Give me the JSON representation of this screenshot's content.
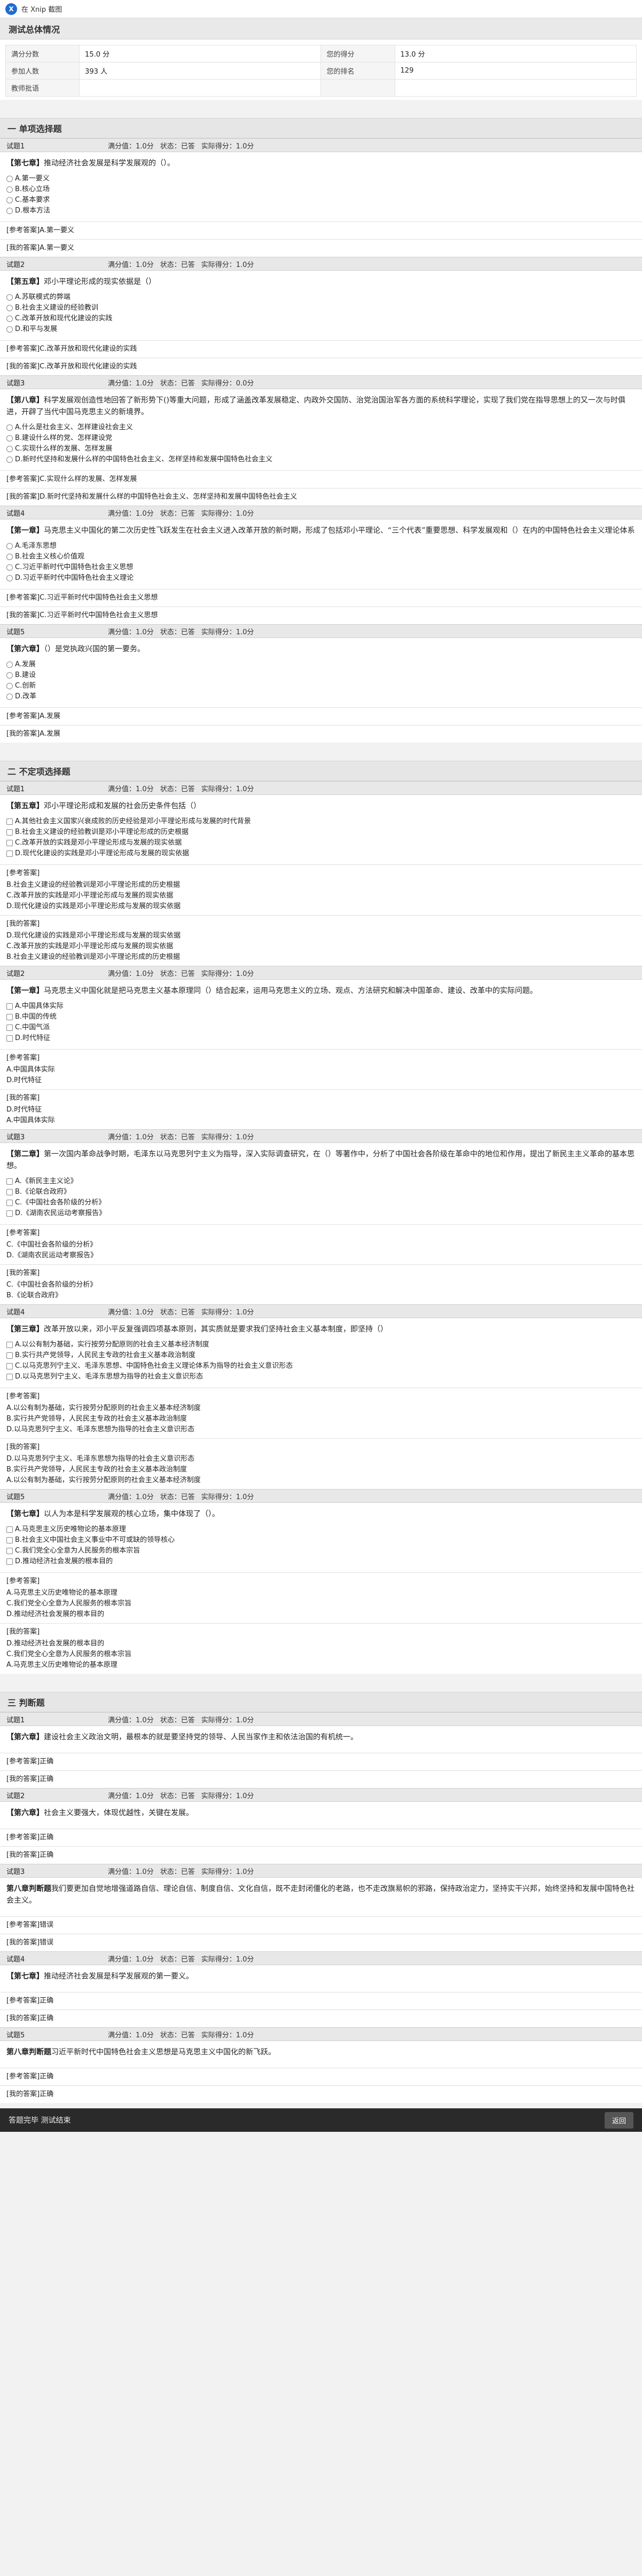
{
  "app": {
    "brand": "在 Xnip 截图",
    "logo_letter": "X"
  },
  "overview": {
    "title": "测试总体情况",
    "rows": [
      {
        "l1": "满分分数",
        "v1": "15.0 分",
        "l2": "您的得分",
        "v2": "13.0 分"
      },
      {
        "l1": "参加人数",
        "v1": "393 人",
        "l2": "您的排名",
        "v2": "129"
      },
      {
        "l1": "教师批语",
        "v1": "",
        "l2": "",
        "v2": ""
      }
    ]
  },
  "labels": {
    "full": "满分值：",
    "status": "状态：",
    "actual": "实际得分：",
    "ref": "[参考答案]",
    "mine": "[我的答案]"
  },
  "sections": [
    {
      "title": "一 单项选择题",
      "questions": [
        {
          "no": "试题1",
          "full": "1.0分",
          "status": "已答",
          "score": "1.0分",
          "tag": "【第七章】",
          "stem": "推动经济社会发展是科学发展观的（）。",
          "options": [
            "A.第一要义",
            "B.核心立场",
            "C.基本要求",
            "D.根本方法"
          ],
          "ref": "A.第一要义",
          "mine": "A.第一要义"
        },
        {
          "no": "试题2",
          "full": "1.0分",
          "status": "已答",
          "score": "1.0分",
          "tag": "【第五章】",
          "stem": "邓小平理论形成的现实依据是（）",
          "options": [
            "A.苏联模式的弊端",
            "B.社会主义建设的经验教训",
            "C.改革开放和现代化建设的实践",
            "D.和平与发展"
          ],
          "ref": "C.改革开放和现代化建设的实践",
          "mine": "C.改革开放和现代化建设的实践"
        },
        {
          "no": "试题3",
          "full": "1.0分",
          "status": "已答",
          "score": "0.0分",
          "tag": "【第八章】",
          "stem": "科学发展观创造性地回答了新形势下()等重大问题，形成了涵盖改革发展稳定、内政外交国防、治党治国治军各方面的系统科学理论，实现了我们党在指导思想上的又一次与时俱进，开辟了当代中国马克思主义的新境界。",
          "options": [
            "A.什么是社会主义、怎样建设社会主义",
            "B.建设什么样的党、怎样建设党",
            "C.实现什么样的发展、怎样发展",
            "D.新时代坚持和发展什么样的中国特色社会主义、怎样坚持和发展中国特色社会主义"
          ],
          "ref": "C.实现什么样的发展、怎样发展",
          "mine": "D.新时代坚持和发展什么样的中国特色社会主义、怎样坚持和发展中国特色社会主义"
        },
        {
          "no": "试题4",
          "full": "1.0分",
          "status": "已答",
          "score": "1.0分",
          "tag": "【第一章】",
          "stem": "马克思主义中国化的第二次历史性飞跃发生在社会主义进入改革开放的新时期，形成了包括邓小平理论、“三个代表”重要思想、科学发展观和（）在内的中国特色社会主义理论体系",
          "options": [
            "A.毛泽东思想",
            "B.社会主义核心价值观",
            "C.习近平新时代中国特色社会主义思想",
            "D.习近平新时代中国特色社会主义理论"
          ],
          "ref": "C.习近平新时代中国特色社会主义思想",
          "mine": "C.习近平新时代中国特色社会主义思想"
        },
        {
          "no": "试题5",
          "full": "1.0分",
          "status": "已答",
          "score": "1.0分",
          "tag": "【第六章】",
          "stem": "（）是党执政兴国的第一要务。",
          "options": [
            "A.发展",
            "B.建设",
            "C.创新",
            "D.改革"
          ],
          "ref": "A.发展",
          "mine": "A.发展"
        }
      ]
    },
    {
      "title": "二 不定项选择题",
      "questions": [
        {
          "no": "试题1",
          "full": "1.0分",
          "status": "已答",
          "score": "1.0分",
          "tag": "【第五章】",
          "stem": "邓小平理论形成和发展的社会历史条件包括（）",
          "options": [
            "A.其他社会主义国家兴衰成败的历史经验是邓小平理论形成与发展的时代背景",
            "B.社会主义建设的经验教训是邓小平理论形成的历史根据",
            "C.改革开放的实践是邓小平理论形成与发展的现实依据",
            "D.现代化建设的实践是邓小平理论形成与发展的现实依据"
          ],
          "ref": "B.社会主义建设的经验教训是邓小平理论形成的历史根据\nC.改革开放的实践是邓小平理论形成与发展的现实依据\nD.现代化建设的实践是邓小平理论形成与发展的现实依据",
          "mine": "D.现代化建设的实践是邓小平理论形成与发展的现实依据\nC.改革开放的实践是邓小平理论形成与发展的现实依据\nB.社会主义建设的经验教训是邓小平理论形成的历史根据"
        },
        {
          "no": "试题2",
          "full": "1.0分",
          "status": "已答",
          "score": "1.0分",
          "tag": "【第一章】",
          "stem": "马克思主义中国化就是把马克思主义基本原理同（）结合起来，运用马克思主义的立场、观点、方法研究和解决中国革命、建设、改革中的实际问题。",
          "options": [
            "A.中国具体实际",
            "B.中国的传统",
            "C.中国气派",
            "D.时代特征"
          ],
          "ref": "A.中国具体实际\nD.时代特征",
          "mine": "D.时代特征\nA.中国具体实际"
        },
        {
          "no": "试题3",
          "full": "1.0分",
          "status": "已答",
          "score": "1.0分",
          "tag": "【第二章】",
          "stem": "第一次国内革命战争时期，毛泽东以马克思列宁主义为指导，深入实际调查研究，在（）等著作中，分析了中国社会各阶级在革命中的地位和作用，提出了新民主主义革命的基本思想。",
          "options": [
            "A.《新民主主义论》",
            "B.《论联合政府》",
            "C.《中国社会各阶级的分析》",
            "D.《湖南农民运动考察报告》"
          ],
          "ref": "C.《中国社会各阶级的分析》\nD.《湖南农民运动考察报告》",
          "mine": "C.《中国社会各阶级的分析》\nB.《论联合政府》"
        },
        {
          "no": "试题4",
          "full": "1.0分",
          "status": "已答",
          "score": "1.0分",
          "tag": "【第三章】",
          "stem": "改革开放以来，邓小平反复强调四项基本原则，其实质就是要求我们坚持社会主义基本制度，即坚持（）",
          "options": [
            "A.以公有制为基础，实行按劳分配原则的社会主义基本经济制度",
            "B.实行共产党领导，人民民主专政的社会主义基本政治制度",
            "C.以马克思列宁主义、毛泽东思想、中国特色社会主义理论体系为指导的社会主义意识形态",
            "D.以马克思列宁主义、毛泽东思想为指导的社会主义意识形态"
          ],
          "ref": "A.以公有制为基础，实行按劳分配原则的社会主义基本经济制度\nB.实行共产党领导，人民民主专政的社会主义基本政治制度\nD.以马克思列宁主义、毛泽东思想为指导的社会主义意识形态",
          "mine": "D.以马克思列宁主义、毛泽东思想为指导的社会主义意识形态\nB.实行共产党领导，人民民主专政的社会主义基本政治制度\nA.以公有制为基础，实行按劳分配原则的社会主义基本经济制度"
        },
        {
          "no": "试题5",
          "full": "1.0分",
          "status": "已答",
          "score": "1.0分",
          "tag": "【第七章】",
          "stem": "以人为本是科学发展观的核心立场，集中体现了（）。",
          "options": [
            "A.马克思主义历史唯物论的基本原理",
            "B.社会主义中国社会主义事业中不可或缺的领导核心",
            "C.我们党全心全意为人民服务的根本宗旨",
            "D.推动经济社会发展的根本目的"
          ],
          "ref": "A.马克思主义历史唯物论的基本原理\nC.我们党全心全意为人民服务的根本宗旨\nD.推动经济社会发展的根本目的",
          "mine": "D.推动经济社会发展的根本目的\nC.我们党全心全意为人民服务的根本宗旨\nA.马克思主义历史唯物论的基本原理"
        }
      ]
    },
    {
      "title": "三 判断题",
      "questions": [
        {
          "no": "试题1",
          "full": "1.0分",
          "status": "已答",
          "score": "1.0分",
          "tag": "【第六章】",
          "stem": "建设社会主义政治文明，最根本的就是要坚持党的领导、人民当家作主和依法治国的有机统一。",
          "options": [],
          "ref": "正确",
          "mine": "正确"
        },
        {
          "no": "试题2",
          "full": "1.0分",
          "status": "已答",
          "score": "1.0分",
          "tag": "【第六章】",
          "stem": "社会主义要强大，体现优越性，关键在发展。",
          "options": [],
          "ref": "正确",
          "mine": "正确"
        },
        {
          "no": "试题3",
          "full": "1.0分",
          "status": "已答",
          "score": "1.0分",
          "tag": "第八章判断题",
          "stem": "我们要更加自觉地增强道路自信、理论自信、制度自信、文化自信，既不走封闭僵化的老路，也不走改旗易帜的邪路，保持政治定力，坚持实干兴邦，始终坚持和发展中国特色社会主义。",
          "options": [],
          "ref": "错误",
          "mine": "错误"
        },
        {
          "no": "试题4",
          "full": "1.0分",
          "status": "已答",
          "score": "1.0分",
          "tag": "【第七章】",
          "stem": "推动经济社会发展是科学发展观的第一要义。",
          "options": [],
          "ref": "正确",
          "mine": "正确"
        },
        {
          "no": "试题5",
          "full": "1.0分",
          "status": "已答",
          "score": "1.0分",
          "tag": "第八章判断题",
          "stem": "习近平新时代中国特色社会主义思想是马克思主义中国化的新飞跃。",
          "options": [],
          "ref": "正确",
          "mine": "正确"
        }
      ]
    }
  ],
  "footer": {
    "text": "答题完毕 测试结束",
    "button": "返回"
  }
}
